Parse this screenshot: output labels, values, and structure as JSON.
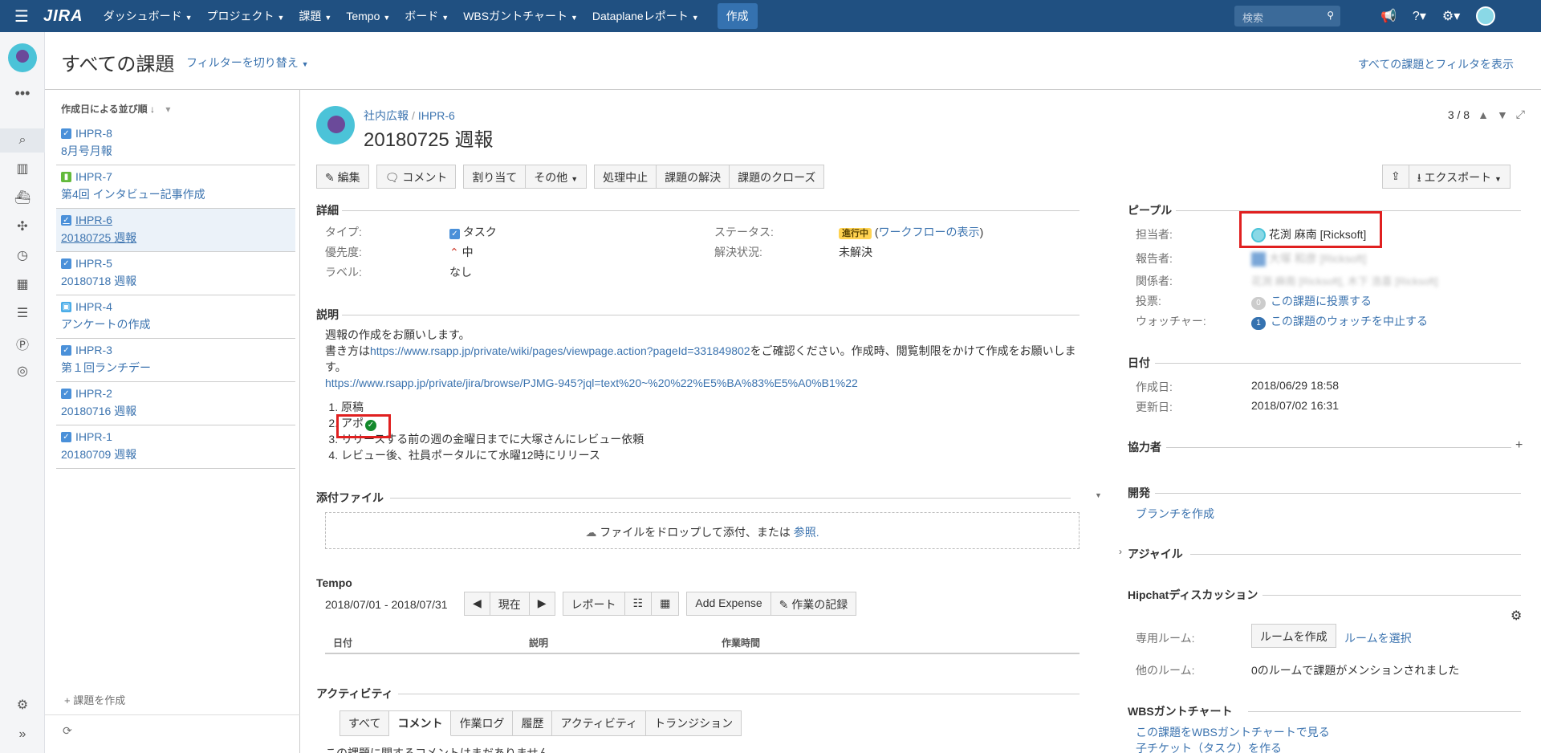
{
  "topbar": {
    "logo": "JIRA",
    "menu": [
      {
        "label": "ダッシュボード"
      },
      {
        "label": "プロジェクト"
      },
      {
        "label": "課題"
      },
      {
        "label": "Tempo"
      },
      {
        "label": "ボード"
      },
      {
        "label": "WBSガントチャート"
      },
      {
        "label": "Dataplaneレポート"
      }
    ],
    "create_label": "作成",
    "search_placeholder": "検索"
  },
  "page": {
    "title": "すべての課題",
    "filter_switch": "フィルターを切り替え",
    "all_filters": "すべての課題とフィルタを表示"
  },
  "issue_list": {
    "sort_label": "作成日による並び順",
    "items": [
      {
        "key": "IHPR-8",
        "summary": "8月号月報",
        "type": "task"
      },
      {
        "key": "IHPR-7",
        "summary": "第4回 インタビュー記事作成",
        "type": "story"
      },
      {
        "key": "IHPR-6",
        "summary": "20180725 週報",
        "type": "task",
        "selected": true
      },
      {
        "key": "IHPR-5",
        "summary": "20180718 週報",
        "type": "task"
      },
      {
        "key": "IHPR-4",
        "summary": "アンケートの作成",
        "type": "sub"
      },
      {
        "key": "IHPR-3",
        "summary": "第１回ランチデー",
        "type": "task"
      },
      {
        "key": "IHPR-2",
        "summary": "20180716 週報",
        "type": "task"
      },
      {
        "key": "IHPR-1",
        "summary": "20180709 週報",
        "type": "task"
      }
    ],
    "create_issue": "+ 課題を作成"
  },
  "issue": {
    "project": "社内広報",
    "key": "IHPR-6",
    "title": "20180725 週報",
    "pager": "3 / 8",
    "toolbar": {
      "edit": "編集",
      "comment": "コメント",
      "assign": "割り当て",
      "more": "その他",
      "stop_progress": "処理中止",
      "resolve": "課題の解決",
      "close": "課題のクローズ",
      "export": "エクスポート"
    },
    "details": {
      "heading": "詳細",
      "type_label": "タイプ:",
      "type_value": "タスク",
      "priority_label": "優先度:",
      "priority_value": "中",
      "labels_label": "ラベル:",
      "labels_value": "なし",
      "status_label": "ステータス:",
      "status_value": "進行中",
      "workflow_link": "ワークフローの表示",
      "resolution_label": "解決状況:",
      "resolution_value": "未解決"
    },
    "description": {
      "heading": "説明",
      "line1": "週報の作成をお願いします。",
      "line2_prefix": "書き方は",
      "line2_link": "https://www.rsapp.jp/private/wiki/pages/viewpage.action?pageId=331849802",
      "line2_suffix": "をご確認ください。作成時、閲覧制限をかけて作成をお願いします。",
      "line3_link": "https://www.rsapp.jp/private/jira/browse/PJMG-945?jql=text%20~%20%22%E5%BA%83%E5%A0%B1%22",
      "steps": [
        "原稿",
        "アポ",
        "リリースする前の週の金曜日までに大塚さんにレビュー依頼",
        "レビュー後、社員ポータルにて水曜12時にリリース"
      ]
    },
    "attachments": {
      "heading": "添付ファイル",
      "drop_text": "ファイルをドロップして添付、または",
      "browse": "参照."
    },
    "tempo": {
      "heading": "Tempo",
      "range": "2018/07/01 - 2018/07/31",
      "now": "現在",
      "report": "レポート",
      "add_expense": "Add Expense",
      "log_work": "作業の記録",
      "col_date": "日付",
      "col_desc": "説明",
      "col_time": "作業時間"
    },
    "activity": {
      "heading": "アクティビティ",
      "tabs": [
        "すべて",
        "コメント",
        "作業ログ",
        "履歴",
        "アクティビティ",
        "トランジション"
      ],
      "empty": "この課題に関するコメントはまだありません"
    }
  },
  "people": {
    "heading": "ピープル",
    "assignee_label": "担当者:",
    "assignee": "花渕 麻南 [Ricksoft]",
    "reporter_label": "報告者:",
    "reporter": "大塚 和彦 [Ricksoft]",
    "involved_label": "関係者:",
    "involved": "花渕 麻南 [Ricksoft], 木下 浩喜 [Ricksoft]",
    "votes_label": "投票:",
    "votes_count": "0",
    "vote_link": "この課題に投票する",
    "watchers_label": "ウォッチャー:",
    "watchers_count": "1",
    "watch_link": "この課題のウォッチを中止する"
  },
  "dates": {
    "heading": "日付",
    "created_label": "作成日:",
    "created": "2018/06/29 18:58",
    "updated_label": "更新日:",
    "updated": "2018/07/02 16:31"
  },
  "collaborators": {
    "heading": "協力者"
  },
  "development": {
    "heading": "開発",
    "branch_link": "ブランチを作成"
  },
  "agile": {
    "heading": "アジャイル"
  },
  "hipchat": {
    "heading": "Hipchatディスカッション",
    "room_label": "専用ルーム:",
    "create_room": "ルームを作成",
    "select_room": "ルームを選択",
    "other_label": "他のルーム:",
    "other_value": "0のルームで課題がメンションされました"
  },
  "wbs": {
    "heading": "WBSガントチャート",
    "link1": "この課題をWBSガントチャートで見る",
    "link2": "子チケット（タスク）を作る"
  },
  "colors": {
    "topbar": "#205081",
    "link": "#3b73af",
    "highlight": "#e02020",
    "status_inprogress": "#ffd351"
  }
}
